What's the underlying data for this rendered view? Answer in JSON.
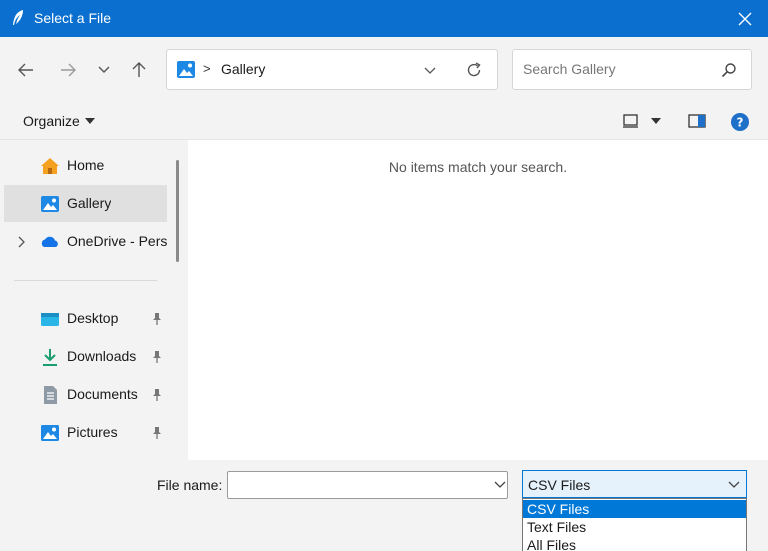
{
  "window": {
    "title": "Select a File"
  },
  "address": {
    "location": "Gallery",
    "separator": ">"
  },
  "search": {
    "placeholder": "Search Gallery"
  },
  "toolbar": {
    "organize_label": "Organize"
  },
  "sidebar": {
    "items": [
      {
        "label": "Home",
        "icon": "home-icon"
      },
      {
        "label": "Gallery",
        "icon": "gallery-icon",
        "selected": true
      },
      {
        "label": "OneDrive - Perso",
        "icon": "onedrive-icon"
      },
      {
        "label": "Desktop",
        "icon": "desktop-icon",
        "pinned": true
      },
      {
        "label": "Downloads",
        "icon": "downloads-icon",
        "pinned": true
      },
      {
        "label": "Documents",
        "icon": "documents-icon",
        "pinned": true
      },
      {
        "label": "Pictures",
        "icon": "pictures-icon",
        "pinned": true
      }
    ]
  },
  "content": {
    "empty_message": "No items match your search."
  },
  "bottom": {
    "file_name_label": "File name:",
    "file_name_value": "",
    "file_type_selected": "CSV Files",
    "file_type_options": [
      "CSV Files",
      "Text Files",
      "All Files"
    ]
  },
  "colors": {
    "titlebar": "#0a6fce",
    "accent": "#0078d7",
    "chrome": "#f3f3f3"
  }
}
